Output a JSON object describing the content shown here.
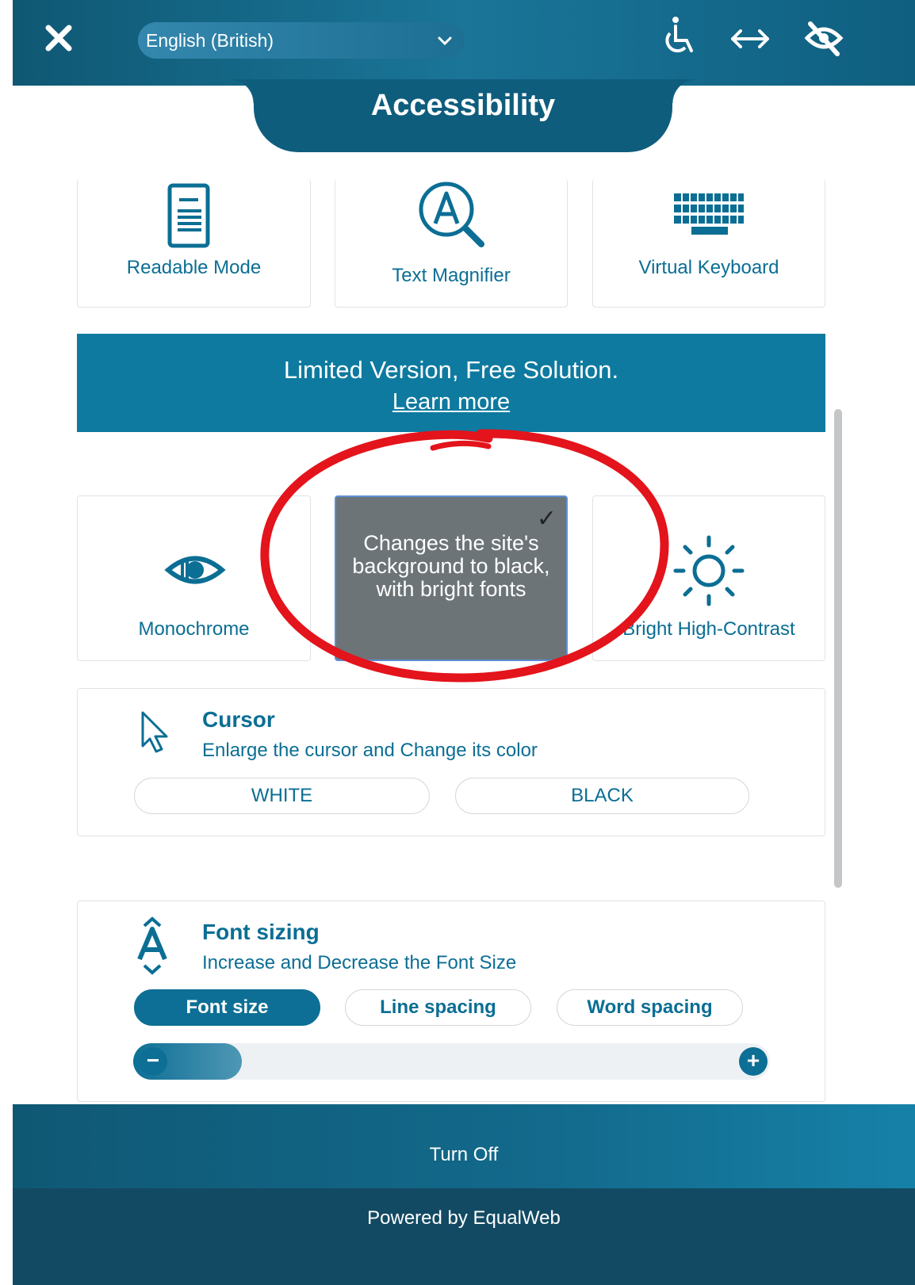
{
  "header": {
    "language": "English (British)",
    "icons": [
      "close-icon",
      "chevron-down-icon",
      "wheelchair-icon",
      "horizontal-arrows-icon",
      "eye-slash-icon"
    ]
  },
  "title": "Accessibility",
  "top_cards": [
    {
      "label": "Readable Mode",
      "icon": "document-icon"
    },
    {
      "label": "Text Magnifier",
      "icon": "magnifier-icon"
    },
    {
      "label": "Virtual Keyboard",
      "icon": "keyboard-icon"
    }
  ],
  "banner": {
    "title": "Limited Version, Free Solution.",
    "link": "Learn more"
  },
  "contrast_cards": [
    {
      "label": "Monochrome",
      "icon": "eye-icon"
    },
    {
      "tooltip": "Changes the site's background to black, with bright fonts",
      "check": "✓"
    },
    {
      "label": "Bright High-Contrast",
      "icon": "sun-icon"
    }
  ],
  "cursor": {
    "title": "Cursor",
    "description": "Enlarge the cursor and Change its color",
    "options": [
      "WHITE",
      "BLACK"
    ]
  },
  "font_sizing": {
    "title": "Font sizing",
    "description": "Increase and Decrease the Font Size",
    "tabs": [
      "Font size",
      "Line spacing",
      "Word spacing"
    ],
    "active_tab": "Font size",
    "minus": "−",
    "plus": "+",
    "level": 0.17
  },
  "footer": {
    "turn_off": "Turn Off",
    "powered_by": "Powered by EqualWeb"
  },
  "colors": {
    "primary": "#0d6f95",
    "header_dark": "#0f5874",
    "tooltip_bg": "#6c7478",
    "annotation": "#e3141b"
  }
}
